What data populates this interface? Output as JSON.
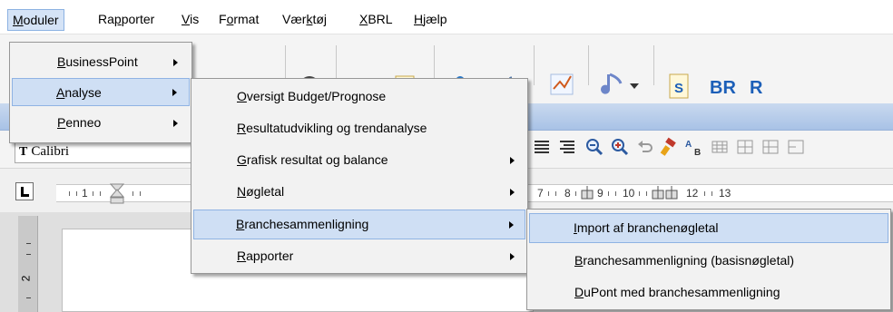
{
  "menubar": {
    "items": [
      {
        "pre": "",
        "key": "M",
        "post": "oduler"
      },
      {
        "pre": "Ra",
        "key": "p",
        "post": "porter"
      },
      {
        "pre": "",
        "key": "V",
        "post": "is"
      },
      {
        "pre": "F",
        "key": "o",
        "post": "rmat"
      },
      {
        "pre": "Vær",
        "key": "k",
        "post": "tøj"
      },
      {
        "pre": "",
        "key": "X",
        "post": "BRL"
      },
      {
        "pre": "",
        "key": "H",
        "post": "jælp"
      }
    ]
  },
  "moduler_menu": {
    "items": [
      {
        "pre": "",
        "key": "B",
        "post": "usinessPoint"
      },
      {
        "pre": "",
        "key": "A",
        "post": "nalyse"
      },
      {
        "pre": "",
        "key": "P",
        "post": "enneo"
      }
    ]
  },
  "analyse_menu": {
    "items": [
      {
        "pre": "",
        "key": "O",
        "post": "versigt Budget/Prognose"
      },
      {
        "pre": "",
        "key": "R",
        "post": "esultatudvikling og trendanalyse"
      },
      {
        "pre": "",
        "key": "G",
        "post": "rafisk resultat og balance"
      },
      {
        "pre": "",
        "key": "N",
        "post": "øgletal"
      },
      {
        "pre": "",
        "key": "B",
        "post": "ranchesammenligning"
      },
      {
        "pre": "",
        "key": "R",
        "post": "apporter"
      }
    ]
  },
  "branche_menu": {
    "items": [
      {
        "pre": "",
        "key": "I",
        "post": "mport af branchenøgletal"
      },
      {
        "pre": "",
        "key": "B",
        "post": "ranchesammenligning (basisnøgletal)"
      },
      {
        "pre": "",
        "key": "D",
        "post": "uPont med branchesammenligning"
      }
    ]
  },
  "toolbar": {
    "font_prefix": "T",
    "font_name": "Calibri",
    "bold_s_label": "S",
    "br_label": "BR",
    "r_label": "R"
  },
  "ruler": {
    "numbers": [
      "1",
      "7",
      "8",
      "9",
      "10",
      "12",
      "13"
    ],
    "vertical_number": "2"
  },
  "colors": {
    "highlight_bg": "#cfdff4",
    "highlight_border": "#8fb3e3",
    "menu_bg": "#f2f2f2",
    "ribbon": "#b7cdea"
  }
}
